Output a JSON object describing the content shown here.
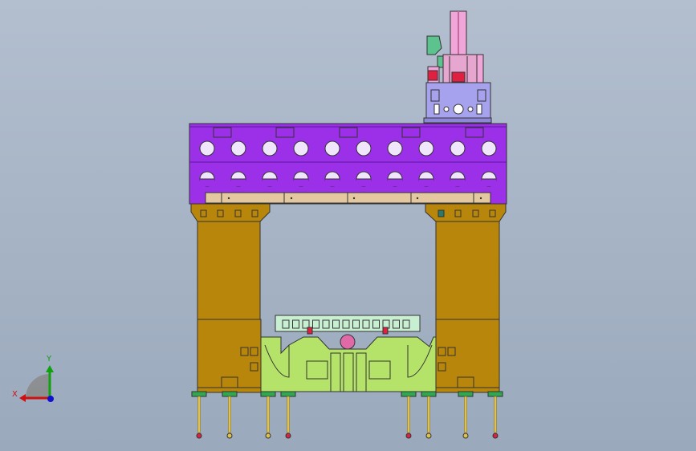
{
  "viewport": {
    "background_top": "#b3bfcf",
    "background_bottom": "#9aa9bc"
  },
  "triad": {
    "x_label": "X",
    "y_label": "Y",
    "x_color": "#d01010",
    "y_color": "#10a010",
    "z_color": "#1010d0"
  },
  "model": {
    "crossbeam_color": "#9b30e8",
    "column_color": "#b8860b",
    "bed_color": "#b5e36a",
    "top_unit_color": "#a7a2ee",
    "rail_color": "#e3c8a0",
    "upper_die_color": "#c9efd2",
    "accent_pink": "#f0a6d8",
    "accent_red": "#e02040",
    "leg_color": "#e2c14a"
  }
}
